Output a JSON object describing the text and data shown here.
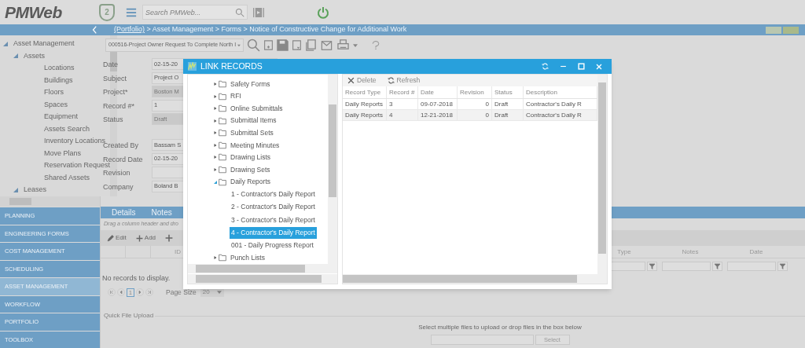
{
  "header": {
    "logo": "PMWeb",
    "badge": "2",
    "search": {
      "placeholder": "Search PMWeb..."
    }
  },
  "breadcrumb": {
    "link": "(Portfolio)",
    "path": " > Asset Management > Forms > Notice of Constructive Change for Additional Work"
  },
  "sidebar": {
    "tree": [
      {
        "label": "Asset Management",
        "expanded": true,
        "children": [
          {
            "label": "Assets",
            "expanded": true,
            "children": [
              {
                "label": "Locations"
              },
              {
                "label": "Buildings"
              },
              {
                "label": "Floors"
              },
              {
                "label": "Spaces"
              },
              {
                "label": "Equipment"
              },
              {
                "label": "Assets Search"
              },
              {
                "label": "Inventory Locations"
              },
              {
                "label": "Move Plans"
              },
              {
                "label": "Reservation Request"
              },
              {
                "label": "Shared Assets"
              }
            ]
          },
          {
            "label": "Leases",
            "expanded": true
          }
        ]
      }
    ],
    "modules": [
      {
        "label": "PLANNING",
        "selected": false
      },
      {
        "label": "ENGINEERING FORMS",
        "selected": false
      },
      {
        "label": "COST MANAGEMENT",
        "selected": false
      },
      {
        "label": "SCHEDULING",
        "selected": false
      },
      {
        "label": "ASSET MANAGEMENT",
        "selected": true
      },
      {
        "label": "WORKFLOW",
        "selected": false
      },
      {
        "label": "PORTFOLIO",
        "selected": false
      },
      {
        "label": "TOOLBOX",
        "selected": false
      }
    ]
  },
  "record_selector": "000516-Project Owner Request To Complete North I",
  "form": [
    {
      "label": "Date",
      "value": "02-15-20",
      "disabled": false,
      "kind": "text"
    },
    {
      "label": "Subject",
      "value": "Project O",
      "disabled": false,
      "kind": "text"
    },
    {
      "label": "Project*",
      "value": "Boston M",
      "disabled": true,
      "kind": "text"
    },
    {
      "label": "Record #*",
      "value": "1",
      "disabled": false,
      "kind": "text"
    },
    {
      "label": "Status",
      "value": "Draft",
      "disabled": true,
      "kind": "tall"
    },
    {
      "label": "Created By",
      "value": "Bassam S",
      "disabled": false,
      "kind": "text"
    },
    {
      "label": "Record Date",
      "value": "02-15-20",
      "disabled": false,
      "kind": "text"
    },
    {
      "label": "Revision",
      "disabled": false,
      "kind": "text"
    },
    {
      "label": "Company",
      "value": "Boland B",
      "disabled": false,
      "kind": "text"
    }
  ],
  "tabs": [
    {
      "label": "Details"
    },
    {
      "label": "Notes"
    }
  ],
  "grid": {
    "group_hint": "Drag a column header and dro",
    "toolbar": [
      "Edit",
      "Add"
    ],
    "columns_left": [
      "ID"
    ],
    "columns_right": [
      "Type",
      "Notes",
      "Date"
    ],
    "empty": "No records to display.",
    "current_page": "1",
    "page_size_label": "Page Size",
    "page_size": "20"
  },
  "upload": {
    "title": "Quick File Upload",
    "hint": "Select multiple files to upload or drop files in the box below",
    "button": "Select"
  },
  "dialog": {
    "title": "LINK RECORDS",
    "tree": [
      {
        "label": "Safety Forms",
        "expanded": false
      },
      {
        "label": "RFI",
        "expanded": false
      },
      {
        "label": "Online Submittals",
        "expanded": false
      },
      {
        "label": "Submittal Items",
        "expanded": false
      },
      {
        "label": "Submittal Sets",
        "expanded": false
      },
      {
        "label": "Meeting Minutes",
        "expanded": false
      },
      {
        "label": "Drawing Lists",
        "expanded": false
      },
      {
        "label": "Drawing Sets",
        "expanded": false
      },
      {
        "label": "Daily Reports",
        "expanded": true,
        "children": [
          {
            "label": "1 - Contractor's Daily Report",
            "selected": false
          },
          {
            "label": "2 - Contractor's Daily Report",
            "selected": false
          },
          {
            "label": "3 - Contractor's Daily Report",
            "selected": false
          },
          {
            "label": "4 - Contractor's Daily Report",
            "selected": true
          },
          {
            "label": "001 - Daily Progress Report",
            "selected": false
          }
        ]
      },
      {
        "label": "Punch Lists",
        "expanded": false
      }
    ],
    "toolbar": [
      "Delete",
      "Refresh"
    ],
    "columns": [
      "Record Type",
      "Record #",
      "Date",
      "Revision",
      "Status",
      "Description"
    ],
    "rows": [
      [
        "Daily Reports",
        "3",
        "09-07-2018",
        "0",
        "Draft",
        "Contractor's Daily R"
      ],
      [
        "Daily Reports",
        "4",
        "12-21-2018",
        "0",
        "Draft",
        "Contractor's Daily R"
      ]
    ]
  }
}
